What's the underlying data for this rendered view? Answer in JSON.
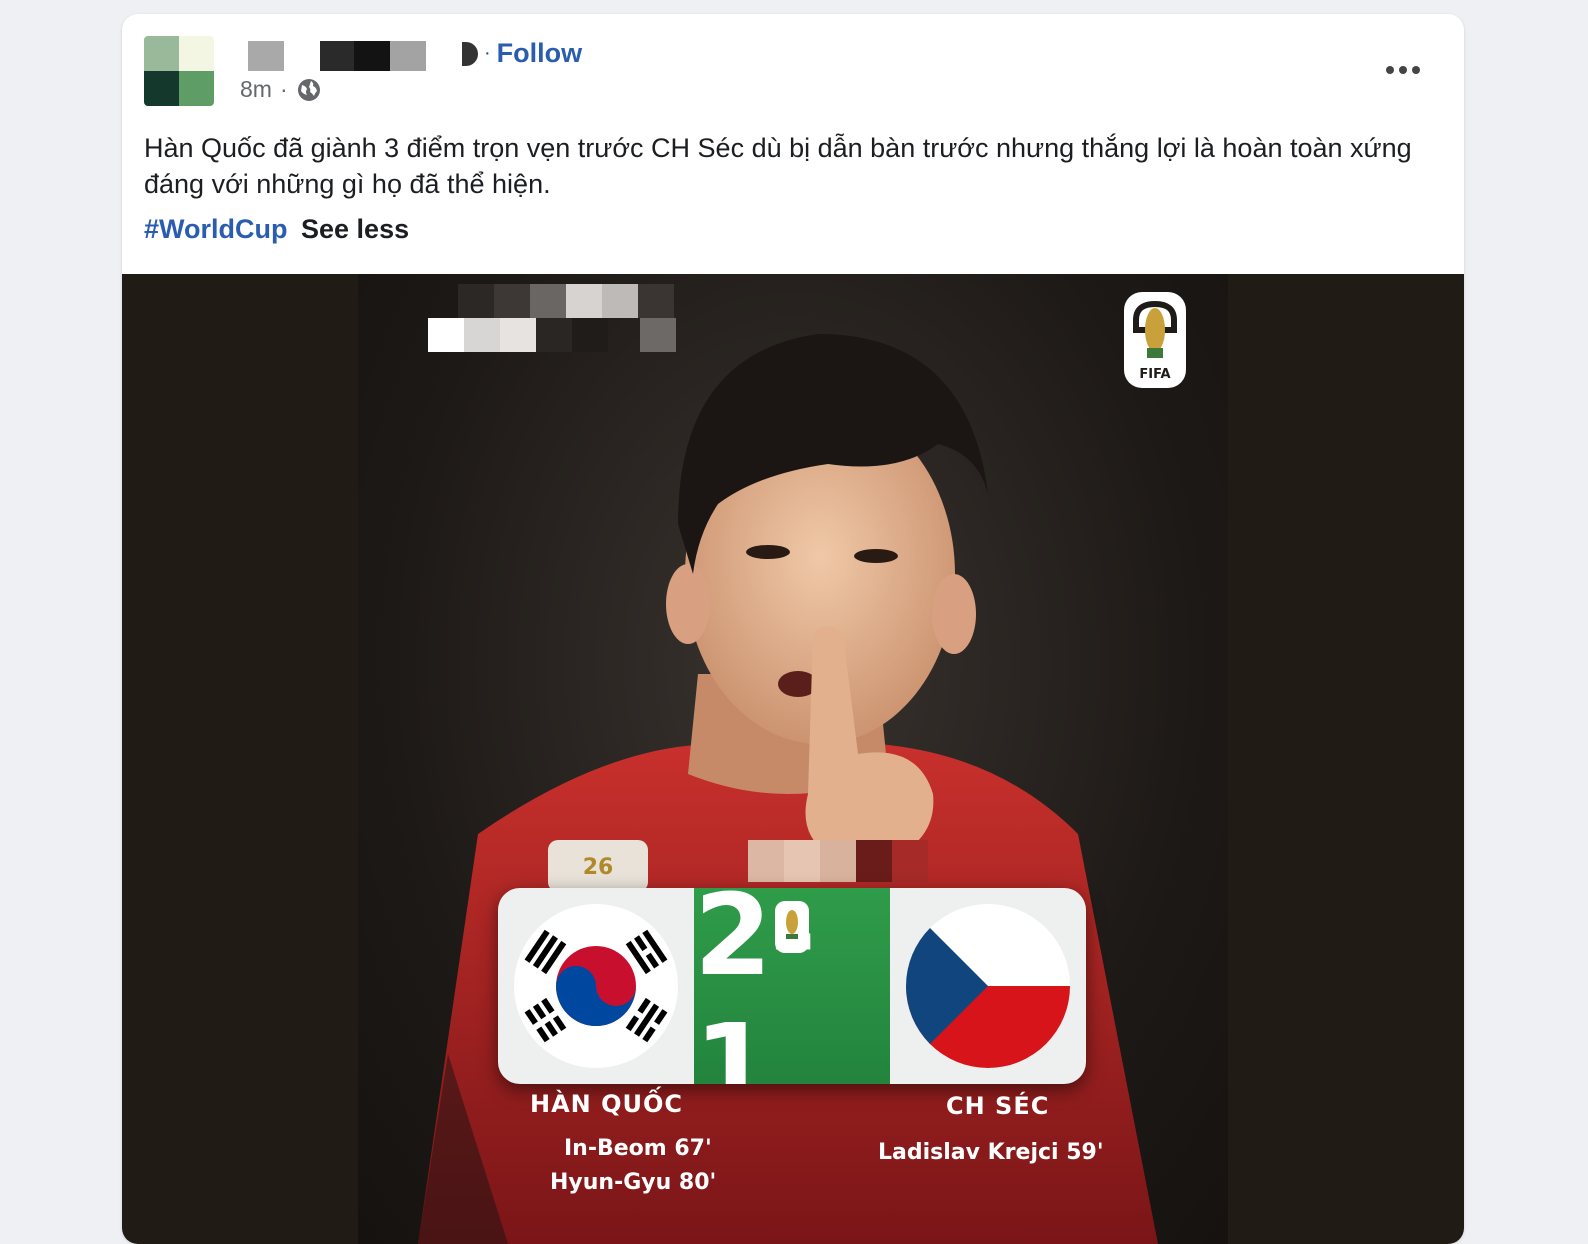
{
  "post": {
    "time": "8m",
    "dot_separator": "·",
    "follow_label": "Follow",
    "follow_separator": "·",
    "caption": "Hàn Quốc đã giành 3 điểm trọn vẹn trước CH Séc dù bị dẫn bàn trước nhưng thắng lợi là hoàn toàn xứng đáng với những gì họ đã thể hiện.",
    "hashtag": "#WorldCup",
    "see_less": "See less",
    "link_color": "#2a5db0"
  },
  "graphic": {
    "fifa_label": "FIFA",
    "score": "2-1",
    "home_team": "HÀN QUỐC",
    "away_team": "CH SÉC",
    "home_scorers": [
      "In-Beom 67'",
      "Hyun-Gyu 80'"
    ],
    "away_scorers": [
      "Ladislav Krejci 59'"
    ],
    "score_color": "#2f9c4a"
  },
  "icons": {
    "privacy": "globe-icon",
    "menu": "more-options-icon"
  }
}
